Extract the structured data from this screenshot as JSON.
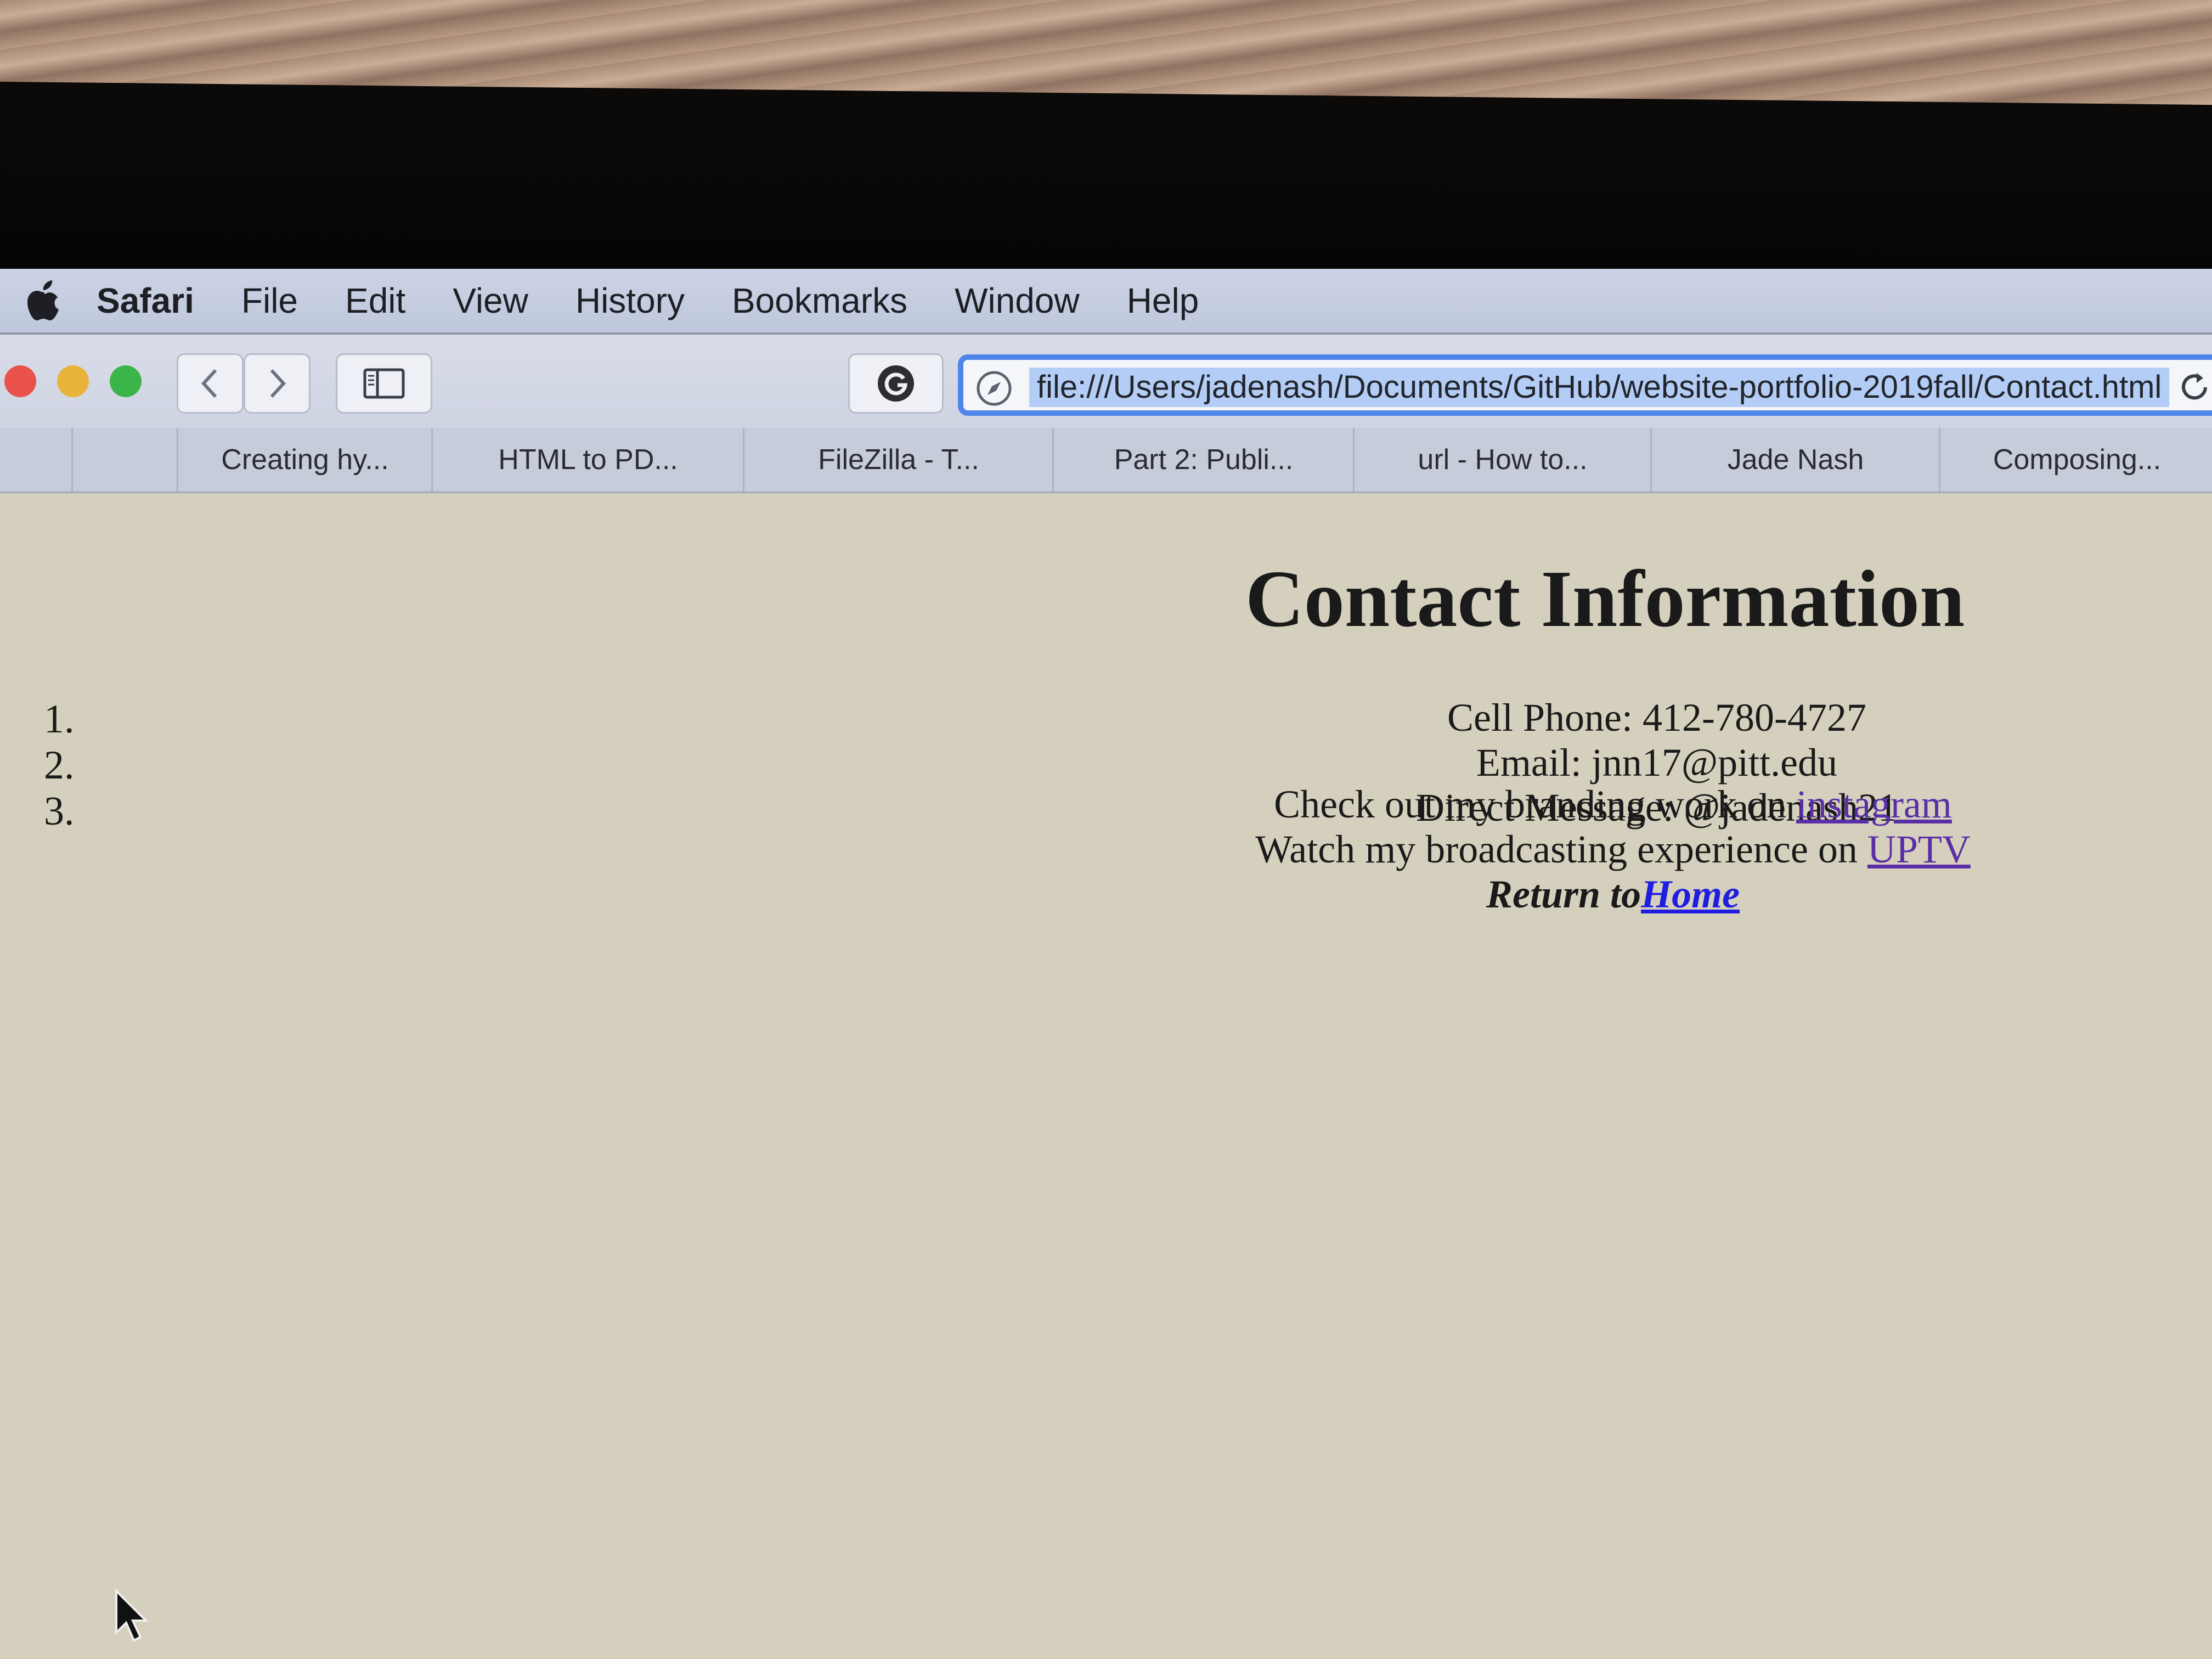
{
  "menubar": {
    "apple_icon": "apple-logo-icon",
    "items": [
      "Safari",
      "File",
      "Edit",
      "View",
      "History",
      "Bookmarks",
      "Window",
      "Help"
    ]
  },
  "toolbar": {
    "traffic_lights": [
      "#e8524a",
      "#e9b23b",
      "#3bb54a"
    ],
    "url": "file:///Users/jadenash/Documents/GitHub/website-portfolio-2019fall/Contact.html",
    "accent": "#4f86e9"
  },
  "bookmarks": [
    "Creating hy...",
    "HTML to PD...",
    "FileZilla - T...",
    "Part 2: Publi...",
    "url - How to...",
    "Jade Nash",
    "Composing..."
  ],
  "page": {
    "heading": "Contact Information",
    "list_numbers": [
      "1.",
      "2.",
      "3."
    ],
    "cell_phone": "Cell Phone: 412-780-4727",
    "email": "Email: jnn17@pitt.edu",
    "direct_message": "Direct Message: @jadenash21",
    "branding_text": "Check out my branding work on ",
    "branding_link": "instagram",
    "broadcast_text": "Watch my broadcasting experience on ",
    "broadcast_link": "UPTV",
    "return_text": "Return to",
    "return_link": "Home"
  }
}
